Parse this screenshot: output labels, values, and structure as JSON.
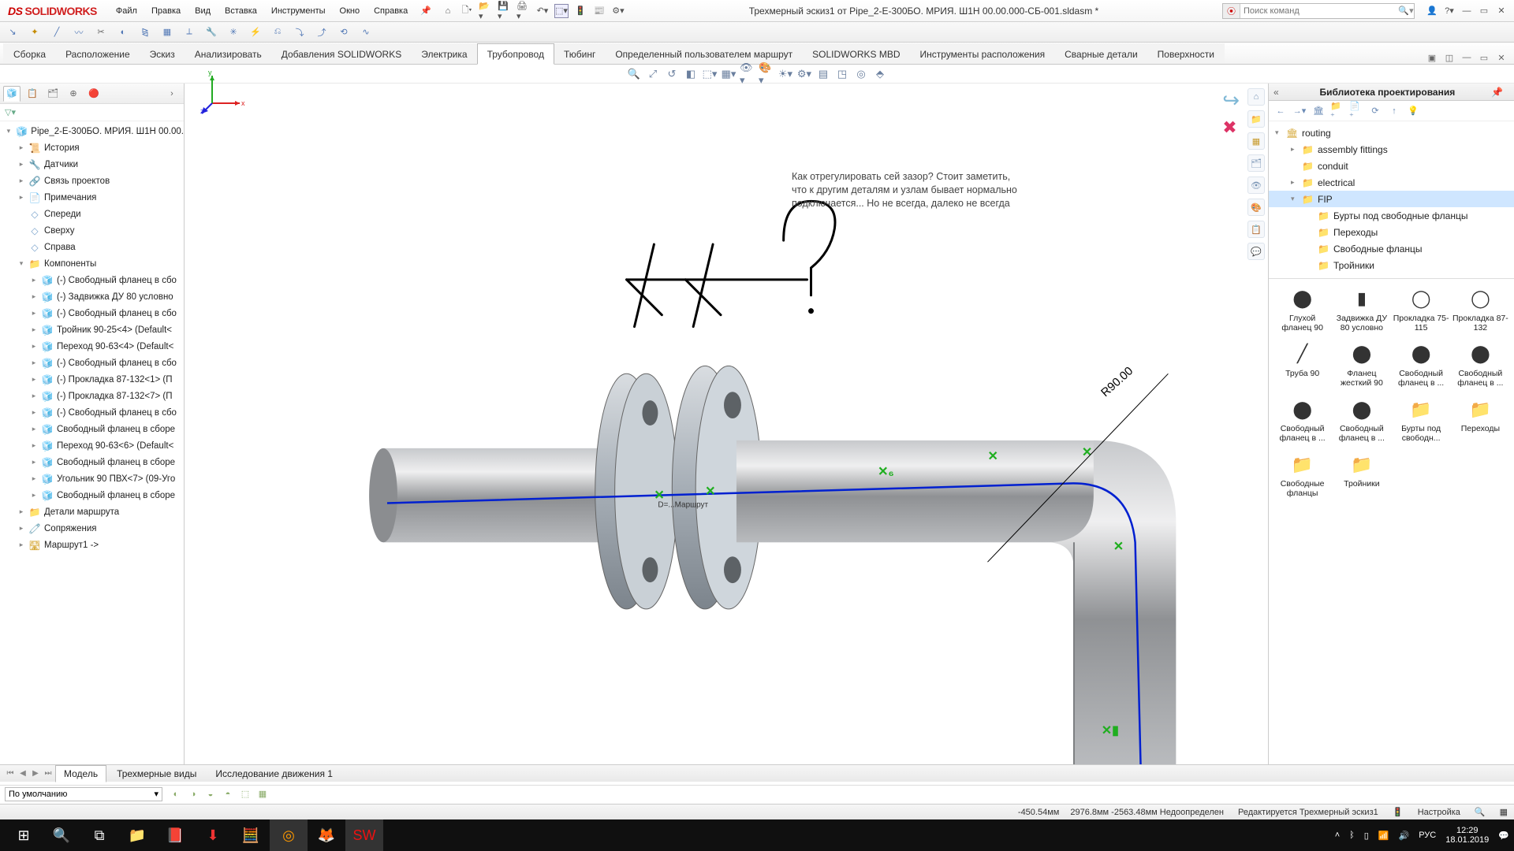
{
  "app": {
    "brand": "SOLIDWORKS"
  },
  "menu": [
    "Файл",
    "Правка",
    "Вид",
    "Вставка",
    "Инструменты",
    "Окно",
    "Справка"
  ],
  "doc_title": "Трехмерный эскиз1 от Pipe_2-Е-300БО. МРИЯ. Ш1Н 00.00.000-СБ-001.sldasm *",
  "search": {
    "placeholder": "Поиск команд"
  },
  "ribbon_tabs": [
    "Сборка",
    "Расположение",
    "Эскиз",
    "Анализировать",
    "Добавления SOLIDWORKS",
    "Электрика",
    "Трубопровод",
    "Тюбинг",
    "Определенный пользователем маршрут",
    "SOLIDWORKS MBD",
    "Инструменты расположения",
    "Сварные детали",
    "Поверхности"
  ],
  "ribbon_active_index": 6,
  "fm": {
    "root": "Pipe_2-Е-300БО. МРИЯ. Ш1Н 00.00.",
    "top_nodes": [
      {
        "icon": "📜",
        "label": "История"
      },
      {
        "icon": "🔧",
        "label": "Датчики"
      },
      {
        "icon": "🔗",
        "label": "Связь проектов"
      },
      {
        "icon": "📄",
        "label": "Примечания"
      },
      {
        "icon": "◇",
        "label": "Спереди",
        "plane": true
      },
      {
        "icon": "◇",
        "label": "Сверху",
        "plane": true
      },
      {
        "icon": "◇",
        "label": "Справа",
        "plane": true
      }
    ],
    "components_label": "Компоненты",
    "components": [
      "(-) Свободный фланец в сбо",
      "(-) Задвижка ДУ 80 условно",
      "(-) Свободный фланец в сбо",
      "Тройник 90-25<4> (Default<",
      "Переход 90-63<4> (Default<",
      "(-) Свободный фланец в сбо",
      "(-) Прокладка 87-132<1> (П",
      "(-) Прокладка 87-132<7> (П",
      "(-) Свободный фланец в сбо",
      "Свободный фланец в сборе",
      "Переход 90-63<6> (Default<",
      "Свободный фланец в сборе",
      "Угольник 90 ПВХ<7> (09-Уго",
      "Свободный фланец в сборе"
    ],
    "bottom_nodes": [
      {
        "icon": "📁",
        "label": "Детали маршрута"
      },
      {
        "icon": "🧷",
        "label": "Сопряжения"
      },
      {
        "icon": "🛣",
        "label": "Маршрут1 ->"
      }
    ]
  },
  "annotation_text": "Как отрегулировать сей зазор? Стоит заметить, что к другим деталям и узлам бывает нормально подключается... Но не всегда, далеко не всегда",
  "radius_label": "R90.00",
  "dlib": {
    "title": "Библиотека проектирования",
    "tree": [
      {
        "exp": "▾",
        "icon": "🏛",
        "label": "routing",
        "ind": 0
      },
      {
        "exp": "▸",
        "icon": "📁",
        "label": "assembly fittings",
        "ind": 1
      },
      {
        "exp": "",
        "icon": "📁",
        "label": "conduit",
        "ind": 1
      },
      {
        "exp": "▸",
        "icon": "📁",
        "label": "electrical",
        "ind": 1
      },
      {
        "exp": "▾",
        "icon": "📁",
        "label": "FIP",
        "ind": 1,
        "sel": true
      },
      {
        "exp": "",
        "icon": "📁",
        "label": "Бурты под свободные фланцы",
        "ind": 2
      },
      {
        "exp": "",
        "icon": "📁",
        "label": "Переходы",
        "ind": 2
      },
      {
        "exp": "",
        "icon": "📁",
        "label": "Свободные фланцы",
        "ind": 2
      },
      {
        "exp": "",
        "icon": "📁",
        "label": "Тройники",
        "ind": 2
      }
    ],
    "thumbs": [
      {
        "pic": "⬤",
        "label": "Глухой фланец 90"
      },
      {
        "pic": "▮",
        "label": "Задвижка ДУ 80 условно"
      },
      {
        "pic": "◯",
        "label": "Прокладка 75-115"
      },
      {
        "pic": "◯",
        "label": "Прокладка 87-132"
      },
      {
        "pic": "╱",
        "label": "Труба 90"
      },
      {
        "pic": "⬤",
        "label": "Фланец жесткий 90"
      },
      {
        "pic": "⬤",
        "label": "Свободный фланец в ..."
      },
      {
        "pic": "⬤",
        "label": "Свободный фланец в ..."
      },
      {
        "pic": "⬤",
        "label": "Свободный фланец в ..."
      },
      {
        "pic": "⬤",
        "label": "Свободный фланец в ..."
      },
      {
        "pic": "📁",
        "label": "Бурты под свободн...",
        "fld": true
      },
      {
        "pic": "📁",
        "label": "Переходы",
        "fld": true
      },
      {
        "pic": "📁",
        "label": "Свободные фланцы",
        "fld": true
      },
      {
        "pic": "📁",
        "label": "Тройники",
        "fld": true
      }
    ]
  },
  "bottom_tabs": [
    "Модель",
    "Трехмерные виды",
    "Исследование движения 1"
  ],
  "bottom_active_index": 0,
  "config_value": "По умолчанию",
  "status": {
    "x": "-450.54мм",
    "yz": "2976.8мм -2563.48мм Недоопределен",
    "mode": "Редактируется Трехмерный эскиз1",
    "custom": "Настройка"
  },
  "taskbar": {
    "lang": "РУС",
    "time": "12:29",
    "date": "18.01.2019"
  }
}
